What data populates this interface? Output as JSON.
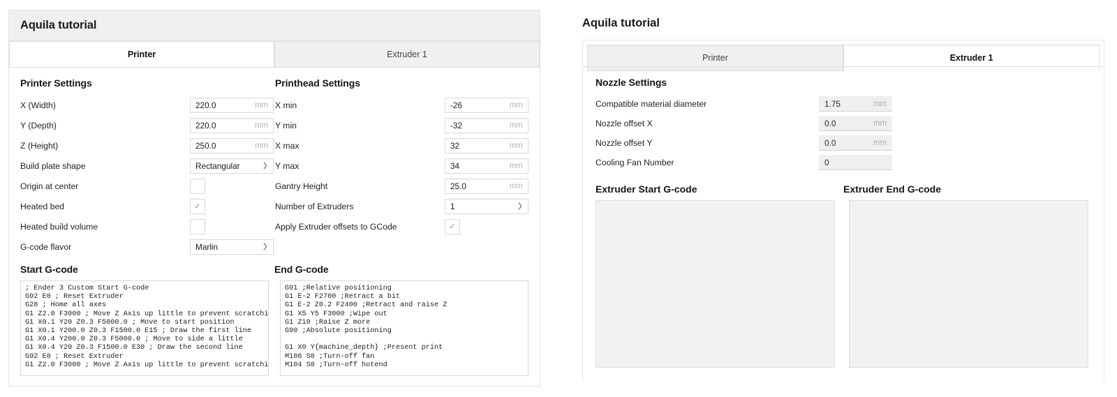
{
  "left_panel": {
    "title": "Aquila tutorial",
    "tabs": [
      {
        "label": "Printer",
        "active": true
      },
      {
        "label": "Extruder 1",
        "active": false
      }
    ],
    "printer_settings": {
      "heading": "Printer Settings",
      "rows": [
        {
          "label": "X (Width)",
          "type": "text",
          "value": "220.0",
          "unit": "mm"
        },
        {
          "label": "Y (Depth)",
          "type": "text",
          "value": "220.0",
          "unit": "mm"
        },
        {
          "label": "Z (Height)",
          "type": "text",
          "value": "250.0",
          "unit": "mm"
        },
        {
          "label": "Build plate shape",
          "type": "select",
          "value": "Rectangular",
          "unit": ""
        },
        {
          "label": "Origin at center",
          "type": "checkbox",
          "value": "",
          "checked": false
        },
        {
          "label": "Heated bed",
          "type": "checkbox",
          "value": "✓",
          "checked": true
        },
        {
          "label": "Heated build volume",
          "type": "checkbox",
          "value": "",
          "checked": false
        },
        {
          "label": "G-code flavor",
          "type": "select",
          "value": "Marlin",
          "unit": ""
        }
      ]
    },
    "printhead_settings": {
      "heading": "Printhead Settings",
      "rows": [
        {
          "label": "X min",
          "type": "text",
          "value": "-26",
          "unit": "mm"
        },
        {
          "label": "Y min",
          "type": "text",
          "value": "-32",
          "unit": "mm"
        },
        {
          "label": "X max",
          "type": "text",
          "value": "32",
          "unit": "mm"
        },
        {
          "label": "Y max",
          "type": "text",
          "value": "34",
          "unit": "mm"
        },
        {
          "label": "Gantry Height",
          "type": "text",
          "value": "25.0",
          "unit": "mm"
        },
        {
          "label": "Number of Extruders",
          "type": "select",
          "value": "1",
          "unit": ""
        },
        {
          "label": "Apply Extruder offsets to GCode",
          "type": "checkbox",
          "value": "✓",
          "checked": true
        }
      ]
    },
    "start_gcode": {
      "heading": "Start G-code",
      "text": "; Ender 3 Custom Start G-code\nG92 E0 ; Reset Extruder\nG28 ; Home all axes\nG1 Z2.0 F3000 ; Move Z Axis up little to prevent scratchir\nG1 X0.1 Y20 Z0.3 F5000.0 ; Move to start position\nG1 X0.1 Y200.0 Z0.3 F1500.0 E15 ; Draw the first line\nG1 X0.4 Y200.0 Z0.3 F5000.0 ; Move to side a little\nG1 X0.4 Y20 Z0.3 F1500.0 E30 ; Draw the second line\nG92 E0 ; Reset Extruder\nG1 Z2.0 F3000 ; Move Z Axis up little to prevent scratchir"
    },
    "end_gcode": {
      "heading": "End G-code",
      "text": "G91 ;Relative positioning\nG1 E-2 F2700 ;Retract a bit\nG1 E-2 Z0.2 F2400 ;Retract and raise Z\nG1 X5 Y5 F3000 ;Wipe out\nG1 Z10 ;Raise Z more\nG90 ;Absolute positioning\n\nG1 X0 Y{machine_depth} ;Present print\nM106 S0 ;Turn-off fan\nM104 S0 ;Turn-off hotend"
    }
  },
  "right_panel": {
    "title": "Aquila tutorial",
    "tabs": [
      {
        "label": "Printer",
        "active": false
      },
      {
        "label": "Extruder 1",
        "active": true
      }
    ],
    "nozzle_settings": {
      "heading": "Nozzle Settings",
      "rows": [
        {
          "label": "Compatible material diameter",
          "value": "1.75",
          "unit": "mm"
        },
        {
          "label": "Nozzle offset X",
          "value": "0.0",
          "unit": "mm"
        },
        {
          "label": "Nozzle offset Y",
          "value": "0.0",
          "unit": "mm"
        },
        {
          "label": "Cooling Fan Number",
          "value": "0",
          "unit": ""
        }
      ]
    },
    "extruder_start_gcode": {
      "heading": "Extruder Start G-code",
      "text": ""
    },
    "extruder_end_gcode": {
      "heading": "Extruder End G-code",
      "text": ""
    }
  },
  "colors": {
    "header_bg": "#f0f0f0",
    "panel_border": "#e2e2e2",
    "control_border": "#d8d8d8",
    "disabled_field_bg": "#efefef",
    "text": "#1a1a1a"
  }
}
